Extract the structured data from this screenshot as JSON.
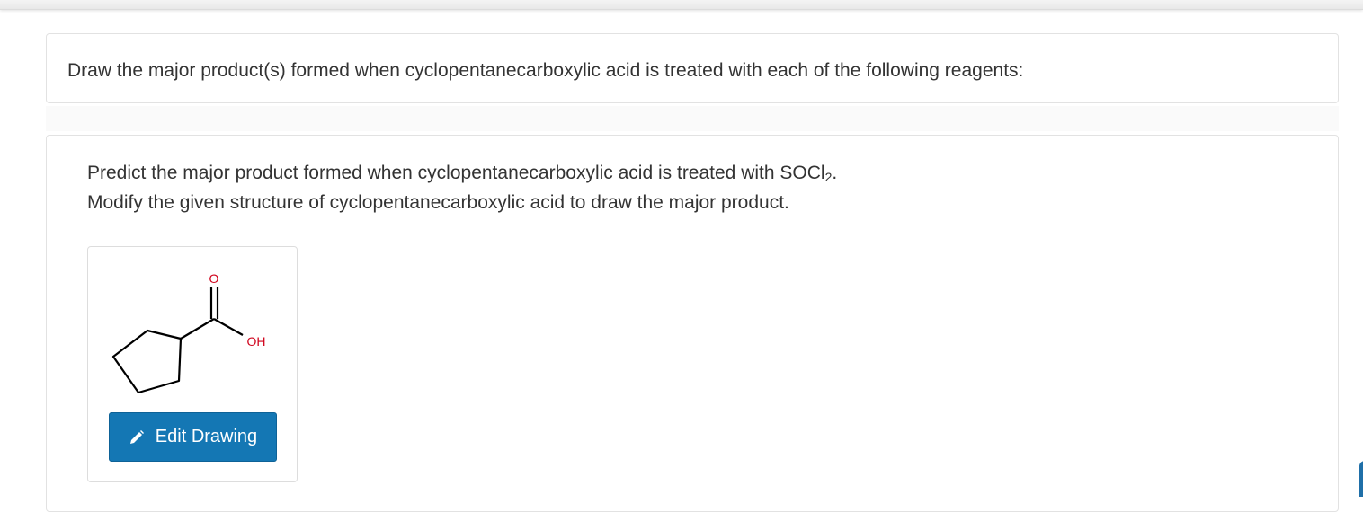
{
  "header": {
    "prompt": "Draw the major product(s) formed when cyclopentanecarboxylic acid is treated with each of the following reagents:"
  },
  "question": {
    "line1_text": "Predict the major product formed when cyclopentanecarboxylic acid is treated with SOCl",
    "line1_subscript": "2",
    "line1_end": ".",
    "line2_text": "Modify the given structure of cyclopentanecarboxylic acid to draw the major product."
  },
  "drawing": {
    "atom_oxygen_label": "O",
    "atom_hydroxyl_label": "OH",
    "heteroatom_color": "#d0021b",
    "bond_color": "#000000"
  },
  "edit_button": {
    "label": "Edit Drawing",
    "icon": "pencil-icon",
    "background": "#1477b4"
  }
}
